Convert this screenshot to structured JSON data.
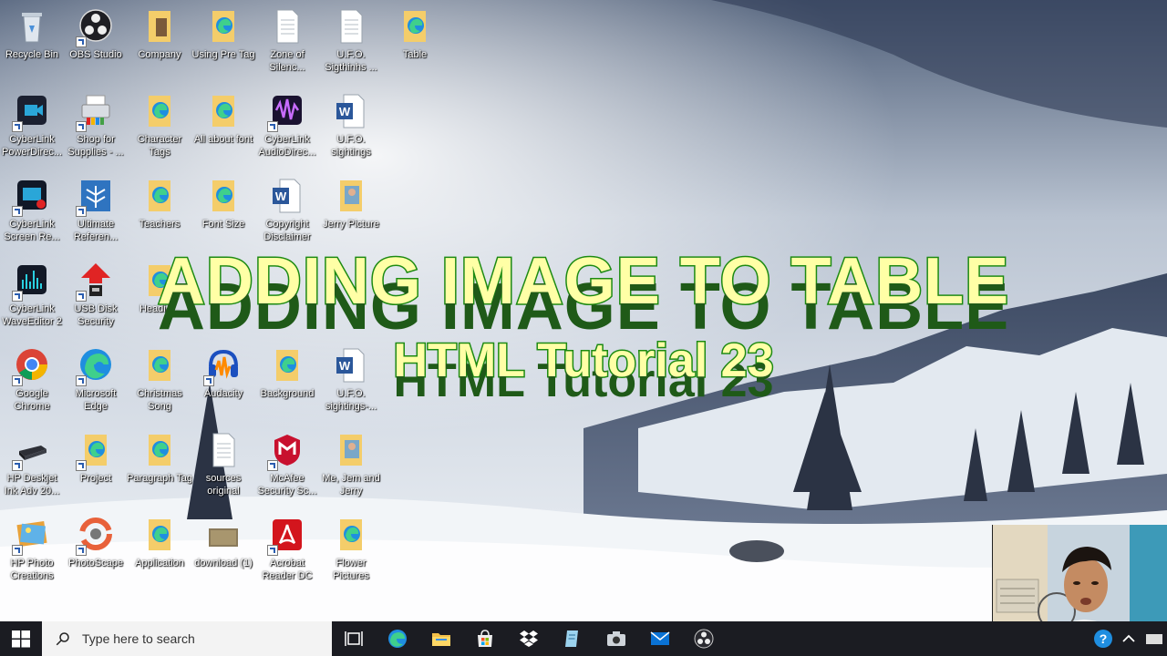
{
  "overlay": {
    "title": "ADDING IMAGE TO TABLE",
    "subtitle": "HTML Tutorial 23"
  },
  "desktop_icons": [
    {
      "label": "Recycle Bin",
      "icon": "recycle-bin-icon"
    },
    {
      "label": "OBS Studio",
      "icon": "obs-studio-icon"
    },
    {
      "label": "Company",
      "icon": "folder-icon"
    },
    {
      "label": "Using Pre Tag",
      "icon": "edge-file-icon"
    },
    {
      "label": "Zone of Silenc...",
      "icon": "text-document-icon"
    },
    {
      "label": "U.F.O. Sigthinhs ...",
      "icon": "text-document-icon"
    },
    {
      "label": "Table",
      "icon": "edge-file-icon"
    },
    {
      "label": "CyberLink PowerDirec...",
      "icon": "powerdirector-icon"
    },
    {
      "label": "Shop for Supplies - ...",
      "icon": "printer-icon"
    },
    {
      "label": "Character Tags",
      "icon": "edge-file-icon"
    },
    {
      "label": "All about font",
      "icon": "edge-file-icon"
    },
    {
      "label": "CyberLink AudioDirec...",
      "icon": "audiodirector-icon"
    },
    {
      "label": "U.F.O. sightings",
      "icon": "word-document-icon"
    },
    {
      "label": "CyberLink Screen Re...",
      "icon": "screen-recorder-icon"
    },
    {
      "label": "Ultimate Referen...",
      "icon": "reference-icon"
    },
    {
      "label": "Teachers",
      "icon": "edge-file-icon"
    },
    {
      "label": "Font Size",
      "icon": "edge-file-icon"
    },
    {
      "label": "Copyright Disclaimer",
      "icon": "word-document-icon"
    },
    {
      "label": "Jerry Picture",
      "icon": "picture-folder-icon"
    },
    {
      "label": "CyberLink WaveEditor 2",
      "icon": "wave-editor-icon"
    },
    {
      "label": "USB Disk Security",
      "icon": "usb-security-icon"
    },
    {
      "label": "Headin...",
      "icon": "edge-file-icon"
    },
    {
      "label": "Google Chrome",
      "icon": "chrome-icon"
    },
    {
      "label": "Microsoft Edge",
      "icon": "edge-icon"
    },
    {
      "label": "Christmas Song",
      "icon": "edge-file-icon"
    },
    {
      "label": "Audacity",
      "icon": "audacity-icon"
    },
    {
      "label": "Background",
      "icon": "edge-file-icon"
    },
    {
      "label": "U.F.O. sightings-...",
      "icon": "word-document-icon"
    },
    {
      "label": "HP Deskjet Ink Adv 20...",
      "icon": "hp-printer-icon"
    },
    {
      "label": "Project",
      "icon": "edge-file-icon"
    },
    {
      "label": "Paragraph Tag",
      "icon": "edge-file-icon"
    },
    {
      "label": "sources original",
      "icon": "text-document-icon"
    },
    {
      "label": "McAfee Security Sc...",
      "icon": "mcafee-icon"
    },
    {
      "label": "Me, Jem and Jerry",
      "icon": "picture-folder-icon"
    },
    {
      "label": "HP Photo Creations",
      "icon": "hp-photo-icon"
    },
    {
      "label": "PhotoScape",
      "icon": "photoscape-icon"
    },
    {
      "label": "Application",
      "icon": "edge-file-icon"
    },
    {
      "label": "download (1)",
      "icon": "image-thumb-icon"
    },
    {
      "label": "Acrobat Reader DC",
      "icon": "acrobat-icon"
    },
    {
      "label": "Flower Pictures",
      "icon": "edge-file-icon"
    }
  ],
  "taskbar": {
    "search_placeholder": "Type here to search",
    "apps": [
      "task-view-icon",
      "edge-icon",
      "file-explorer-icon",
      "store-icon",
      "dropbox-icon",
      "notes-icon",
      "camera-icon",
      "mail-icon",
      "obs-studio-icon"
    ],
    "tray": [
      "help-icon",
      "chevron-up-icon",
      "tray-app-icon"
    ]
  },
  "colors": {
    "taskbar": "#1b1c22",
    "title_fill": "#ffffa6",
    "title_stroke": "#1c8a12"
  }
}
